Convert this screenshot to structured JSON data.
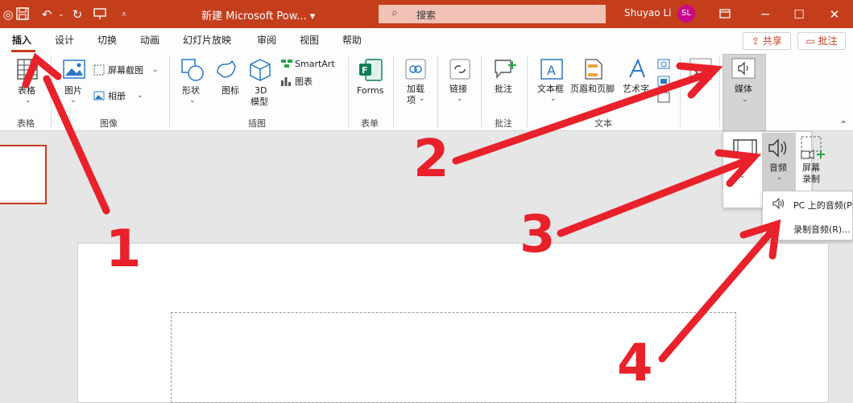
{
  "titlebar": {
    "title": "新建 Microsoft Pow... ▾",
    "search_placeholder": "搜索",
    "user_name": "Shuyao Li",
    "avatar_initials": "SL"
  },
  "tabs": [
    "插入",
    "设计",
    "切换",
    "动画",
    "幻灯片放映",
    "审阅",
    "视图",
    "帮助"
  ],
  "actions": {
    "share": "共享",
    "comment": "批注"
  },
  "ribbon": {
    "table": {
      "label": "表格",
      "group": "表格"
    },
    "image": {
      "picture": "图片",
      "screenshot": "屏幕截图",
      "album": "相册",
      "group": "图像"
    },
    "illustrations": {
      "shapes": "形状",
      "icons": "图标",
      "model3d_line1": "3D",
      "model3d_line2": "模型",
      "smartart": "SmartArt",
      "chart": "图表",
      "group": "插图"
    },
    "forms": {
      "label": "Forms",
      "group": "表单"
    },
    "addins": {
      "label_line1": "加载",
      "label_line2": "项"
    },
    "links": {
      "label": "链接"
    },
    "comments": {
      "label": "批注",
      "group": "批注"
    },
    "text": {
      "textbox": "文本框",
      "headerfooter": "页眉和页脚",
      "wordart": "艺术字",
      "group": "文本"
    },
    "media": {
      "label": "媒体"
    }
  },
  "media_dropdown": {
    "audio": "音频",
    "screen_record_line1": "屏幕",
    "screen_record_line2": "录制"
  },
  "audio_menu": {
    "pc_audio": "PC 上的音频(P",
    "record_audio": "录制音频(R)..."
  },
  "annotations": [
    "1",
    "2",
    "3",
    "4"
  ],
  "colors": {
    "accent": "#c43e1c",
    "arrow": "#e8212a",
    "avatar": "#c80b88"
  }
}
